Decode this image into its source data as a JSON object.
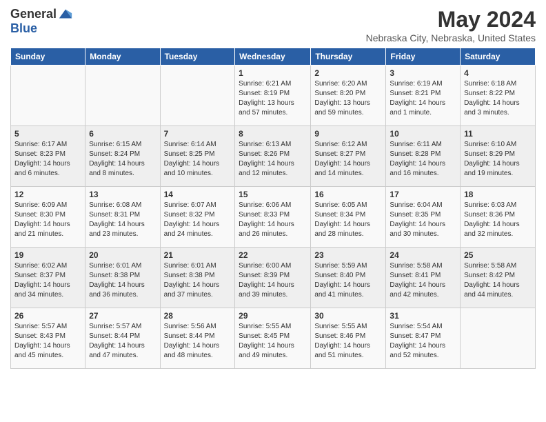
{
  "header": {
    "logo_general": "General",
    "logo_blue": "Blue",
    "title": "May 2024",
    "subtitle": "Nebraska City, Nebraska, United States"
  },
  "calendar": {
    "days_of_week": [
      "Sunday",
      "Monday",
      "Tuesday",
      "Wednesday",
      "Thursday",
      "Friday",
      "Saturday"
    ],
    "weeks": [
      [
        {
          "day": "",
          "content": ""
        },
        {
          "day": "",
          "content": ""
        },
        {
          "day": "",
          "content": ""
        },
        {
          "day": "1",
          "content": "Sunrise: 6:21 AM\nSunset: 8:19 PM\nDaylight: 13 hours\nand 57 minutes."
        },
        {
          "day": "2",
          "content": "Sunrise: 6:20 AM\nSunset: 8:20 PM\nDaylight: 13 hours\nand 59 minutes."
        },
        {
          "day": "3",
          "content": "Sunrise: 6:19 AM\nSunset: 8:21 PM\nDaylight: 14 hours\nand 1 minute."
        },
        {
          "day": "4",
          "content": "Sunrise: 6:18 AM\nSunset: 8:22 PM\nDaylight: 14 hours\nand 3 minutes."
        }
      ],
      [
        {
          "day": "5",
          "content": "Sunrise: 6:17 AM\nSunset: 8:23 PM\nDaylight: 14 hours\nand 6 minutes."
        },
        {
          "day": "6",
          "content": "Sunrise: 6:15 AM\nSunset: 8:24 PM\nDaylight: 14 hours\nand 8 minutes."
        },
        {
          "day": "7",
          "content": "Sunrise: 6:14 AM\nSunset: 8:25 PM\nDaylight: 14 hours\nand 10 minutes."
        },
        {
          "day": "8",
          "content": "Sunrise: 6:13 AM\nSunset: 8:26 PM\nDaylight: 14 hours\nand 12 minutes."
        },
        {
          "day": "9",
          "content": "Sunrise: 6:12 AM\nSunset: 8:27 PM\nDaylight: 14 hours\nand 14 minutes."
        },
        {
          "day": "10",
          "content": "Sunrise: 6:11 AM\nSunset: 8:28 PM\nDaylight: 14 hours\nand 16 minutes."
        },
        {
          "day": "11",
          "content": "Sunrise: 6:10 AM\nSunset: 8:29 PM\nDaylight: 14 hours\nand 19 minutes."
        }
      ],
      [
        {
          "day": "12",
          "content": "Sunrise: 6:09 AM\nSunset: 8:30 PM\nDaylight: 14 hours\nand 21 minutes."
        },
        {
          "day": "13",
          "content": "Sunrise: 6:08 AM\nSunset: 8:31 PM\nDaylight: 14 hours\nand 23 minutes."
        },
        {
          "day": "14",
          "content": "Sunrise: 6:07 AM\nSunset: 8:32 PM\nDaylight: 14 hours\nand 24 minutes."
        },
        {
          "day": "15",
          "content": "Sunrise: 6:06 AM\nSunset: 8:33 PM\nDaylight: 14 hours\nand 26 minutes."
        },
        {
          "day": "16",
          "content": "Sunrise: 6:05 AM\nSunset: 8:34 PM\nDaylight: 14 hours\nand 28 minutes."
        },
        {
          "day": "17",
          "content": "Sunrise: 6:04 AM\nSunset: 8:35 PM\nDaylight: 14 hours\nand 30 minutes."
        },
        {
          "day": "18",
          "content": "Sunrise: 6:03 AM\nSunset: 8:36 PM\nDaylight: 14 hours\nand 32 minutes."
        }
      ],
      [
        {
          "day": "19",
          "content": "Sunrise: 6:02 AM\nSunset: 8:37 PM\nDaylight: 14 hours\nand 34 minutes."
        },
        {
          "day": "20",
          "content": "Sunrise: 6:01 AM\nSunset: 8:38 PM\nDaylight: 14 hours\nand 36 minutes."
        },
        {
          "day": "21",
          "content": "Sunrise: 6:01 AM\nSunset: 8:38 PM\nDaylight: 14 hours\nand 37 minutes."
        },
        {
          "day": "22",
          "content": "Sunrise: 6:00 AM\nSunset: 8:39 PM\nDaylight: 14 hours\nand 39 minutes."
        },
        {
          "day": "23",
          "content": "Sunrise: 5:59 AM\nSunset: 8:40 PM\nDaylight: 14 hours\nand 41 minutes."
        },
        {
          "day": "24",
          "content": "Sunrise: 5:58 AM\nSunset: 8:41 PM\nDaylight: 14 hours\nand 42 minutes."
        },
        {
          "day": "25",
          "content": "Sunrise: 5:58 AM\nSunset: 8:42 PM\nDaylight: 14 hours\nand 44 minutes."
        }
      ],
      [
        {
          "day": "26",
          "content": "Sunrise: 5:57 AM\nSunset: 8:43 PM\nDaylight: 14 hours\nand 45 minutes."
        },
        {
          "day": "27",
          "content": "Sunrise: 5:57 AM\nSunset: 8:44 PM\nDaylight: 14 hours\nand 47 minutes."
        },
        {
          "day": "28",
          "content": "Sunrise: 5:56 AM\nSunset: 8:44 PM\nDaylight: 14 hours\nand 48 minutes."
        },
        {
          "day": "29",
          "content": "Sunrise: 5:55 AM\nSunset: 8:45 PM\nDaylight: 14 hours\nand 49 minutes."
        },
        {
          "day": "30",
          "content": "Sunrise: 5:55 AM\nSunset: 8:46 PM\nDaylight: 14 hours\nand 51 minutes."
        },
        {
          "day": "31",
          "content": "Sunrise: 5:54 AM\nSunset: 8:47 PM\nDaylight: 14 hours\nand 52 minutes."
        },
        {
          "day": "",
          "content": ""
        }
      ]
    ]
  }
}
